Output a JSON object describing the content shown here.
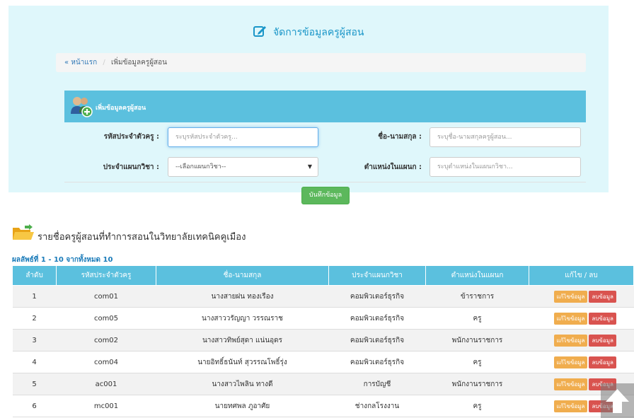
{
  "header": {
    "title": "จัดการข้อมูลครูผู้สอน",
    "title_icon": "edit-icon"
  },
  "breadcrumb": {
    "home": "« หน้าแรก",
    "separator": "/",
    "current": "เพิ่มข้อมูลครูผู้สอน"
  },
  "form": {
    "header": "เพิ่มข้อมูลครูผู้สอน",
    "header_icon": "add-teacher-icon",
    "teacher_id_label": "รหัสประจำตัวครู :",
    "teacher_id_placeholder": "ระบุรหัสประจำตัวครู...",
    "name_label": "ชื่อ-นามสกุล :",
    "name_placeholder": "ระบุชื่อ-นามสกุลครูผู้สอน...",
    "department_label": "ประจำแผนกวิชา :",
    "department_selected": "--เลือกแผนกวิชา--",
    "position_label": "ตำแหน่งในแผนก :",
    "position_placeholder": "ระบุตำแหน่งในแผนกวิชา...",
    "save_button": "บันทึกข้อมูล"
  },
  "list": {
    "title": "รายชื่อครูผู้สอนที่ทำการสอนในวิทยาลัยเทคนิคคูเมือง",
    "title_icon": "folder-open-icon",
    "results": "ผลลัพธ์ที่ 1 - 10 จากทั้งหมด 10",
    "columns": [
      "ลำดับ",
      "รหัสประจำตัวครู",
      "ชื่อ-นามสกุล",
      "ประจำแผนกวิชา",
      "ตำแหน่งในแผนก",
      "แก้ไข / ลบ"
    ],
    "edit_label": "แก้ไขข้อมูล",
    "delete_label": "ลบข้อมูล",
    "rows": [
      {
        "no": "1",
        "id": "com01",
        "name": "นางสายฝน ทองเรือง",
        "dept": "คอมพิวเตอร์ธุรกิจ",
        "position": "ข้าราชการ"
      },
      {
        "no": "2",
        "id": "com05",
        "name": "นางสาววรัญญา วรรณราช",
        "dept": "คอมพิวเตอร์ธุรกิจ",
        "position": "ครู"
      },
      {
        "no": "3",
        "id": "com02",
        "name": "นางสาวทิพย์สุดา แน่นอุดร",
        "dept": "คอมพิวเตอร์ธุรกิจ",
        "position": "พนักงานราชการ"
      },
      {
        "no": "4",
        "id": "com04",
        "name": "นายอิทธิ์ธนันท์ สุวรรณโพธิ์รุ่ง",
        "dept": "คอมพิวเตอร์ธุรกิจ",
        "position": "ครู"
      },
      {
        "no": "5",
        "id": "ac001",
        "name": "นางสาวไพลิน ทางดี",
        "dept": "การบัญชี",
        "position": "พนักงานราชการ"
      },
      {
        "no": "6",
        "id": "mc001",
        "name": "นายทศพล ภูอาศัย",
        "dept": "ช่างกลโรงงาน",
        "position": "ครู"
      }
    ]
  },
  "scroll_top_icon": "arrow-up-icon",
  "colors": {
    "panel_bg": "#dff7fb",
    "accent": "#5bc0de",
    "save": "#5cb85c",
    "edit": "#f0ad4e",
    "delete": "#d9534f"
  }
}
